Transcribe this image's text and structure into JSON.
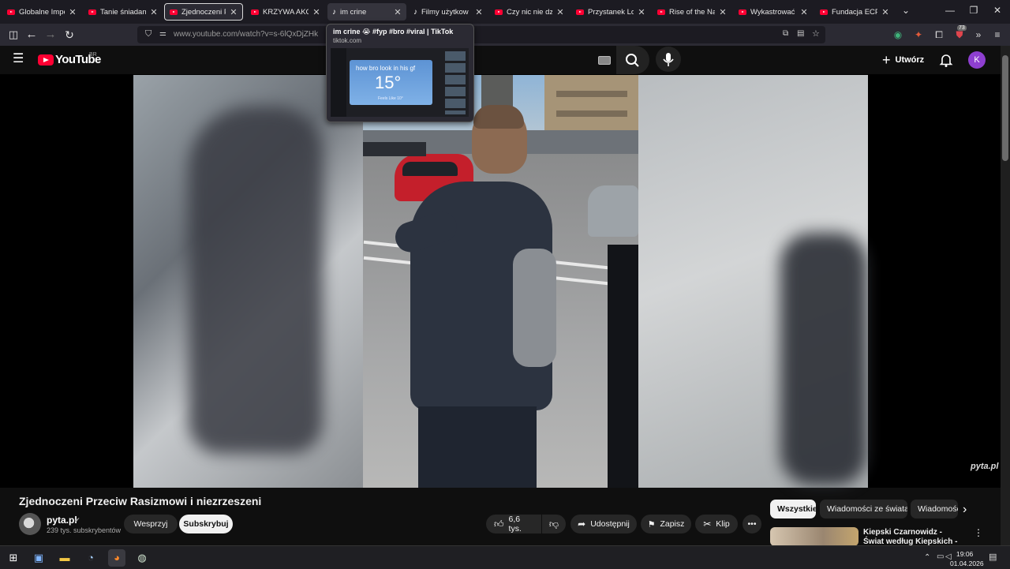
{
  "browser": {
    "tabs": [
      {
        "label": "Globalne Imperium",
        "favicon": "youtube-icon"
      },
      {
        "label": "Tanie śniadanie w",
        "favicon": "youtube-icon"
      },
      {
        "label": "Zjednoczeni Przec",
        "favicon": "youtube-icon",
        "active": true
      },
      {
        "label": "KRZYWA AKCJA #",
        "favicon": "youtube-icon"
      },
      {
        "label": "im crine",
        "favicon": "tiktok-icon",
        "hovered": true
      },
      {
        "label": "Filmy użytkow",
        "favicon": "tiktok-icon"
      },
      {
        "label": "Czy nic nie dzieje",
        "favicon": "youtube-icon"
      },
      {
        "label": "Przystanek Lomba",
        "favicon": "youtube-icon"
      },
      {
        "label": "Rise of the Nazis",
        "favicon": "youtube-icon"
      },
      {
        "label": "Wykastrować bez",
        "favicon": "youtube-icon"
      },
      {
        "label": "Fundacja ECPU Po",
        "favicon": "youtube-icon"
      }
    ],
    "url": "www.youtube.com/watch?v=s-6lQxDjZHk",
    "extension_badge": "73",
    "tooltip": {
      "title": "im crine 😭 #fyp #bro #viral | TikTok",
      "host": "tiktok.com",
      "thumb_line": "how bro look in his gf",
      "thumb_temp": "15°",
      "thumb_feels": "Feels Like 10°"
    }
  },
  "youtube": {
    "logo_text": "YouTube",
    "region": "BR",
    "create_label": "Utwórz",
    "avatar_letter": "K",
    "video": {
      "title": "Zjednoczeni Przeciw Rasizmowi i niezrzeszeni",
      "watermark": "pyta.pl",
      "channel": "pyta.pl",
      "subscribers": "239 tys. subskrybentów",
      "support_label": "Wesprzyj",
      "subscribe_label": "Subskrybuj",
      "likes": "6,6 tys.",
      "share_label": "Udostępnij",
      "save_label": "Zapisz",
      "clip_label": "Klip"
    },
    "chips": [
      "Wszystkie",
      "Wiadomości ze świata",
      "Wiadomości"
    ],
    "recommendation": {
      "title": "Kiepski Czarnowidz - Świat według Kiepskich - CAŁY ..."
    }
  },
  "taskbar": {
    "time": "19:06",
    "date": "01.04.2026"
  },
  "colors": {
    "brand_red": "#ff0033",
    "bg": "#0f0f0f",
    "avatar": "#8e3fd0"
  }
}
